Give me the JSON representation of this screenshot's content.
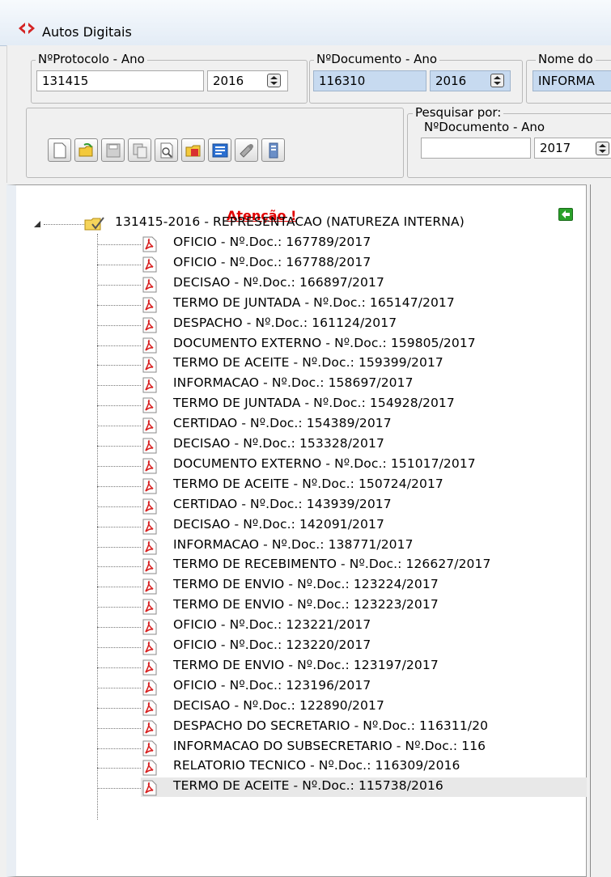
{
  "window": {
    "title": "Autos Digitais"
  },
  "protocol": {
    "label": "NºProtocolo - Ano",
    "number": "131415",
    "year": "2016"
  },
  "document": {
    "label": "NºDocumento - Ano",
    "number": "116310",
    "year": "2016"
  },
  "doc_name": {
    "label": "Nome do",
    "value": "INFORMA"
  },
  "search": {
    "group_label": "Pesquisar por:",
    "field_label": "NºDocumento - Ano",
    "number": "",
    "year": "2017"
  },
  "toolbar": {
    "buttons": [
      "new-document-icon",
      "open-folder-icon",
      "save-icon",
      "copy-icon",
      "preview-icon",
      "folder-report-icon",
      "form-icon",
      "tools-icon",
      "notes-icon"
    ]
  },
  "tree": {
    "header": "Atenção !",
    "root_label": "131415-2016 - REPRESENTACAO (NATUREZA INTERNA)",
    "selected_index": 25,
    "items": [
      "OFICIO - Nº.Doc.: 167789/2017",
      "OFICIO - Nº.Doc.: 167788/2017",
      "DECISAO - Nº.Doc.: 166897/2017",
      "TERMO DE JUNTADA - Nº.Doc.: 165147/2017",
      "DESPACHO - Nº.Doc.: 161124/2017",
      "DOCUMENTO EXTERNO - Nº.Doc.: 159805/2017",
      "TERMO DE ACEITE - Nº.Doc.: 159399/2017",
      "INFORMACAO - Nº.Doc.: 158697/2017",
      "TERMO DE JUNTADA - Nº.Doc.: 154928/2017",
      "CERTIDAO - Nº.Doc.: 154389/2017",
      "DECISAO - Nº.Doc.: 153328/2017",
      "DOCUMENTO EXTERNO - Nº.Doc.: 151017/2017",
      "TERMO DE ACEITE - Nº.Doc.: 150724/2017",
      "CERTIDAO - Nº.Doc.: 143939/2017",
      "DECISAO - Nº.Doc.: 142091/2017",
      "INFORMACAO - Nº.Doc.: 138771/2017",
      "TERMO DE RECEBIMENTO - Nº.Doc.: 126627/2017",
      "TERMO DE ENVIO - Nº.Doc.: 123224/2017",
      "TERMO DE ENVIO - Nº.Doc.: 123223/2017",
      "OFICIO - Nº.Doc.: 123221/2017",
      "OFICIO - Nº.Doc.: 123220/2017",
      "TERMO DE ENVIO - Nº.Doc.: 123197/2017",
      "OFICIO - Nº.Doc.: 123196/2017",
      "DECISAO - Nº.Doc.: 122890/2017",
      "DESPACHO DO SECRETARIO - Nº.Doc.: 116311/20",
      "INFORMACAO DO SUBSECRETARIO - Nº.Doc.: 116",
      "RELATORIO TECNICO - Nº.Doc.: 116309/2016",
      "TERMO DE ACEITE - Nº.Doc.: 115738/2016"
    ]
  },
  "colors": {
    "attention": "#e00000",
    "pdf": "#d81e1e",
    "field_highlight": "#c7daf0"
  }
}
